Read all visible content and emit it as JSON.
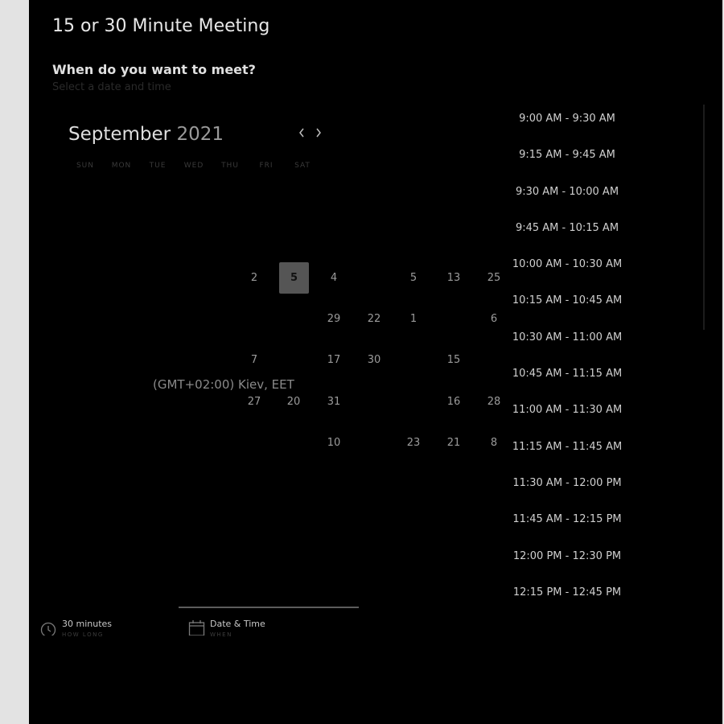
{
  "meeting": {
    "title": "15 or 30 Minute Meeting"
  },
  "prompt": {
    "question": "When do you want to meet?",
    "hint": "Select a date and time"
  },
  "calendar": {
    "month": "September",
    "year": "2021",
    "weekdays": [
      "SUN",
      "MON",
      "TUE",
      "WED",
      "THU",
      "FRI",
      "SAT"
    ],
    "days": [
      {
        "label": "2"
      },
      {
        "label": "5",
        "selected": true
      },
      {
        "label": "4"
      },
      {
        "label": "5"
      },
      {
        "label": "13"
      },
      {
        "label": "25"
      },
      {
        "label": "29"
      },
      {
        "label": "22"
      },
      {
        "label": "1"
      },
      {
        "label": "6"
      },
      {
        "label": "7"
      },
      {
        "label": "17"
      },
      {
        "label": "30"
      },
      {
        "label": "15"
      },
      {
        "label": "27"
      },
      {
        "label": "20"
      },
      {
        "label": "31"
      },
      {
        "label": "16"
      },
      {
        "label": "28"
      },
      {
        "label": "10"
      },
      {
        "label": "23"
      },
      {
        "label": "21"
      },
      {
        "label": "8"
      }
    ]
  },
  "timezone": {
    "label": "(GMT+02:00) Kiev, EET"
  },
  "slots": [
    "9:00 AM - 9:30 AM",
    "9:15 AM - 9:45 AM",
    "9:30 AM - 10:00 AM",
    "9:45 AM - 10:15 AM",
    "10:00 AM - 10:30 AM",
    "10:15 AM - 10:45 AM",
    "10:30 AM - 11:00 AM",
    "10:45 AM - 11:15 AM",
    "11:00 AM - 11:30 AM",
    "11:15 AM - 11:45 AM",
    "11:30 AM - 12:00 PM",
    "11:45 AM - 12:15 PM",
    "12:00 PM - 12:30 PM",
    "12:15 PM - 12:45 PM"
  ],
  "steps": [
    {
      "label": "30 minutes",
      "sub": "HOW LONG",
      "icon": "clock-icon"
    },
    {
      "label": "Date & Time",
      "sub": "WHEN",
      "icon": "calendar-icon",
      "active": true
    }
  ]
}
